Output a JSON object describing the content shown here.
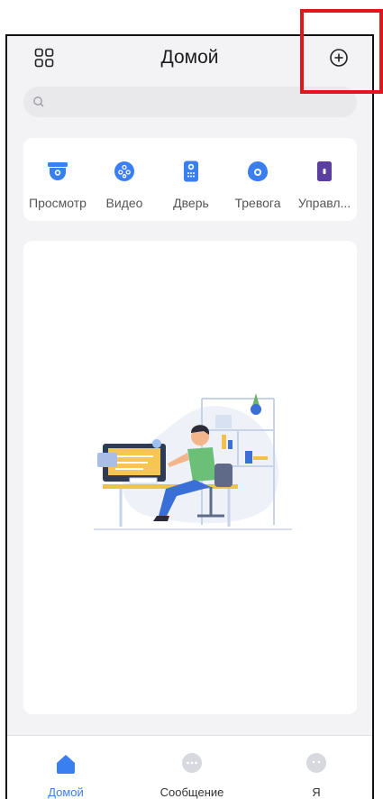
{
  "header": {
    "title": "Домой"
  },
  "search": {
    "placeholder": ""
  },
  "shortcuts": [
    {
      "label": "Просмотр",
      "icon": "camera-dome-icon"
    },
    {
      "label": "Видео",
      "icon": "video-icon"
    },
    {
      "label": "Дверь",
      "icon": "door-intercom-icon"
    },
    {
      "label": "Тревога",
      "icon": "alarm-icon"
    },
    {
      "label": "Управл...",
      "icon": "access-control-icon"
    }
  ],
  "tabs": [
    {
      "label": "Домой",
      "icon": "home-icon",
      "active": true
    },
    {
      "label": "Сообщение",
      "icon": "message-icon",
      "active": false
    },
    {
      "label": "Я",
      "icon": "profile-icon",
      "active": false
    }
  ],
  "colors": {
    "accent": "#3a7ff2",
    "highlight": "#e0161b",
    "background": "#f3f3f5",
    "inactive_icon": "#d7d9de"
  }
}
